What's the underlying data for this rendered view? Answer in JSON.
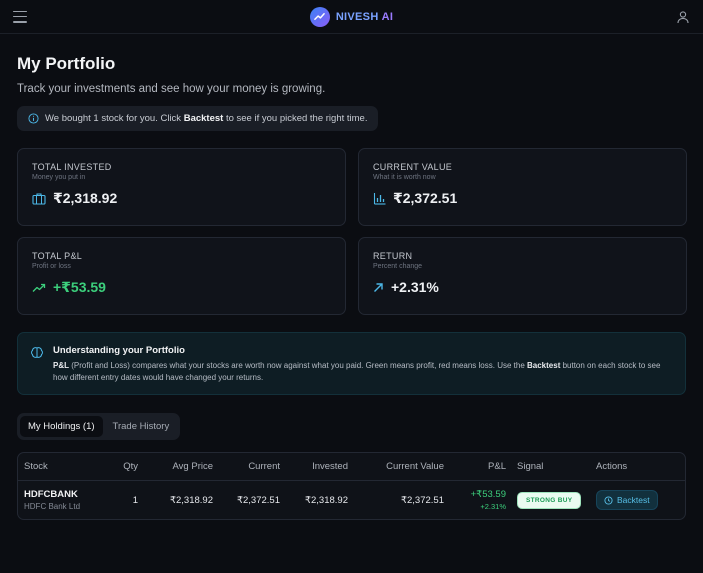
{
  "app": {
    "brand_main": "NIVESH",
    "brand_suffix": "AI"
  },
  "page": {
    "title": "My Portfolio",
    "subtitle": "Track your investments and see how your money is growing.",
    "banner": {
      "prefix": "We bought 1 stock for you. Click ",
      "bold": "Backtest",
      "suffix": " to see if you picked the right time."
    }
  },
  "cards": {
    "invested": {
      "title": "TOTAL INVESTED",
      "sub": "Money you put in",
      "value": "₹2,318.92"
    },
    "current": {
      "title": "CURRENT VALUE",
      "sub": "What it is worth now",
      "value": "₹2,372.51"
    },
    "pl": {
      "title": "TOTAL P&L",
      "sub": "Profit or loss",
      "value": "+₹53.59"
    },
    "return": {
      "title": "RETURN",
      "sub": "Percent change",
      "value": "+2.31%"
    }
  },
  "explain": {
    "title": "Understanding your Portfolio",
    "p1_bold": "P&L",
    "p1": " (Profit and Loss) compares what your stocks are worth now against what you paid. Green means profit, red means loss. Use the ",
    "p1_bold2": "Backtest",
    "p1_end": " button on each stock to see how different entry dates would have changed your returns."
  },
  "tabs": [
    "My Holdings (1)",
    "Trade History"
  ],
  "table": {
    "headers": [
      "Stock",
      "Qty",
      "Avg Price",
      "Current",
      "Invested",
      "Current Value",
      "P&L",
      "Signal",
      "Actions"
    ],
    "rows": [
      {
        "symbol": "HDFCBANK",
        "name": "HDFC Bank Ltd",
        "qty": "1",
        "avg": "₹2,318.92",
        "current": "₹2,372.51",
        "invested": "₹2,318.92",
        "current_value": "₹2,372.51",
        "pl": "+₹53.59",
        "pl_pct": "+2.31%",
        "signal": "STRONG BUY",
        "action": "Backtest"
      }
    ]
  },
  "colors": {
    "accent": "#58c0e8",
    "profit": "#3ccf7c",
    "brand": "#7aa2ff"
  },
  "icons": [
    "menu-icon",
    "brand-trend-icon",
    "user-icon",
    "info-icon",
    "briefcase-icon",
    "bar-chart-icon",
    "trend-up-icon",
    "arrow-up-right-icon",
    "brain-icon",
    "clock-icon"
  ]
}
